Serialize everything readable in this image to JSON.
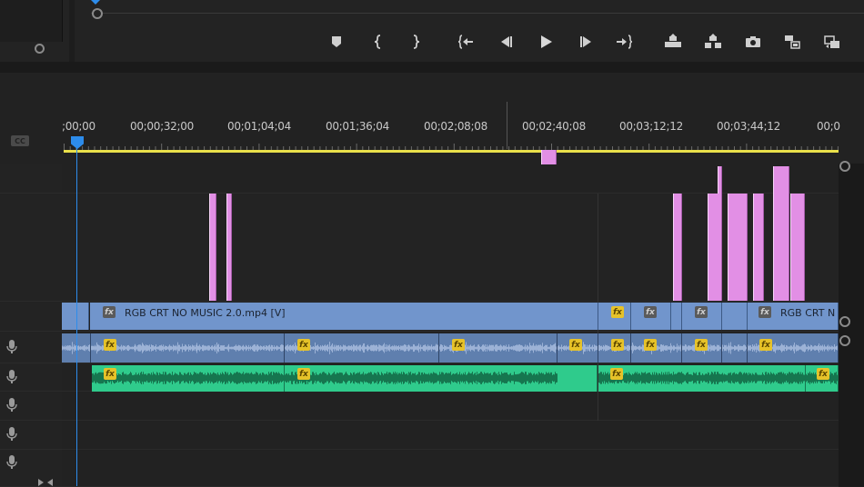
{
  "transport": {
    "buttons": [
      {
        "name": "add-marker",
        "icon": "marker-icon"
      },
      {
        "name": "mark-in",
        "icon": "mark-in-icon"
      },
      {
        "name": "mark-out",
        "icon": "mark-out-icon"
      },
      {
        "name": "go-to-in",
        "icon": "go-to-in-icon"
      },
      {
        "name": "step-back",
        "icon": "step-back-icon"
      },
      {
        "name": "play",
        "icon": "play-icon"
      },
      {
        "name": "step-forward",
        "icon": "step-forward-icon"
      },
      {
        "name": "go-to-out",
        "icon": "go-to-out-icon"
      },
      {
        "name": "lift",
        "icon": "lift-icon"
      },
      {
        "name": "extract",
        "icon": "extract-icon"
      },
      {
        "name": "export-frame",
        "icon": "camera-icon"
      },
      {
        "name": "insert",
        "icon": "insert-icon"
      },
      {
        "name": "overwrite",
        "icon": "overwrite-icon"
      }
    ]
  },
  "timeline": {
    "cc_label": "CC",
    "ruler_labels": [
      ";00;00",
      "00;00;32;00",
      "00;01;04;04",
      "00;01;36;04",
      "00;02;08;08",
      "00;02;40;08",
      "00;03;12;12",
      "00;03;44;12",
      "00;0"
    ],
    "playhead_color": "#2d8ceb",
    "work_area_color": "#e9e04a"
  },
  "clips": {
    "video_main_label": "RGB CRT NO MUSIC 2.0.mp4 [V]",
    "video_end_label": "RGB CRT N",
    "fx_label": "fx"
  },
  "colors": {
    "adjustment": "#e28fe5",
    "video": "#7195cc",
    "audio_linked": "#5f7fae",
    "audio_music": "#2fcb8c"
  }
}
